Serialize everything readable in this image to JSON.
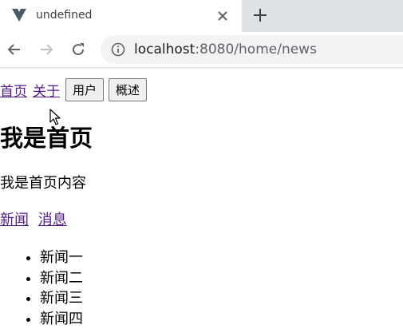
{
  "browser": {
    "tab": {
      "title": "undefined",
      "favicon": "vue-logo-icon",
      "close_icon": "close-icon"
    },
    "new_tab_icon": "plus-icon",
    "toolbar": {
      "back_icon": "arrow-left-icon",
      "forward_icon": "arrow-right-icon",
      "reload_icon": "reload-icon",
      "info_icon": "info-icon"
    },
    "address": {
      "host": "localhost",
      "rest": ":8080/home/news"
    }
  },
  "page": {
    "nav": {
      "links": [
        "首页",
        "关于"
      ],
      "buttons": [
        "用户",
        "概述"
      ]
    },
    "title": "我是首页",
    "content": "我是首页内容",
    "subnav": [
      "新闻",
      "消息"
    ],
    "news": [
      "新闻一",
      "新闻二",
      "新闻三",
      "新闻四"
    ]
  },
  "colors": {
    "link_visited": "#551a8b",
    "vue_logo": "#4c5a6a",
    "tabstrip_bg": "#dee1e6",
    "omnibox_bg": "#f1f3f4"
  }
}
